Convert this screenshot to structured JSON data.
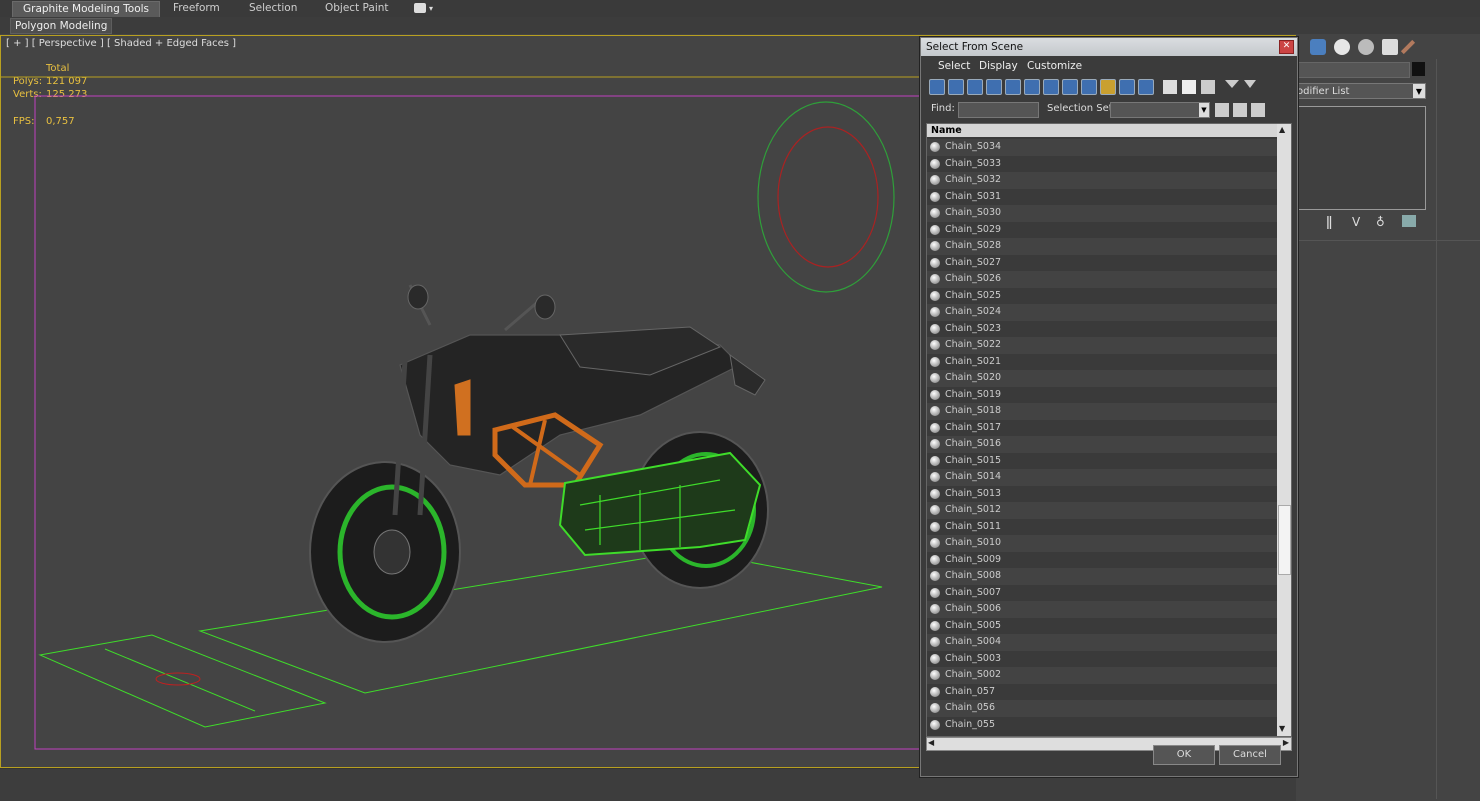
{
  "ribbon": {
    "tabs": [
      "Graphite Modeling Tools",
      "Freeform",
      "Selection",
      "Object Paint"
    ],
    "sub_button": "Polygon Modeling"
  },
  "viewport": {
    "label": "[ + ] [ Perspective ] [ Shaded + Edged Faces ]",
    "stats": {
      "total_label": "Total",
      "polys_label": "Polys:",
      "polys_value": "121 097",
      "verts_label": "Verts:",
      "verts_value": "125 273",
      "fps_label": "FPS:",
      "fps_value": "0,757"
    }
  },
  "command_panel": {
    "modifier_list": "odifier List"
  },
  "dialog": {
    "title": "Select From Scene",
    "menu": [
      "Select",
      "Display",
      "Customize"
    ],
    "find_label": "Find:",
    "selection_set_label": "Selection Set:",
    "column_name": "Name",
    "items": [
      "Chain_S034",
      "Chain_S033",
      "Chain_S032",
      "Chain_S031",
      "Chain_S030",
      "Chain_S029",
      "Chain_S028",
      "Chain_S027",
      "Chain_S026",
      "Chain_S025",
      "Chain_S024",
      "Chain_S023",
      "Chain_S022",
      "Chain_S021",
      "Chain_S020",
      "Chain_S019",
      "Chain_S018",
      "Chain_S017",
      "Chain_S016",
      "Chain_S015",
      "Chain_S014",
      "Chain_S013",
      "Chain_S012",
      "Chain_S011",
      "Chain_S010",
      "Chain_S009",
      "Chain_S008",
      "Chain_S007",
      "Chain_S006",
      "Chain_S005",
      "Chain_S004",
      "Chain_S003",
      "Chain_S002",
      "Chain_057",
      "Chain_056",
      "Chain_055"
    ],
    "ok_label": "OK",
    "cancel_label": "Cancel"
  },
  "colors": {
    "viewport_border": "#b8a020",
    "stats": "#e8c040",
    "wire_green": "#3fdc2a",
    "frame_orange": "#d06a1a",
    "magenta_frame": "#c040c0"
  }
}
